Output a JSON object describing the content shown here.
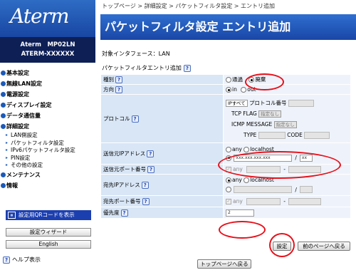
{
  "sidebar": {
    "logo": "Aterm",
    "model_line1": "Aterm　MP02LN",
    "model_line2": "ATERM-XXXXXX",
    "menu": [
      {
        "label": "基本設定"
      },
      {
        "label": "無線LAN設定"
      },
      {
        "label": "電源設定"
      },
      {
        "label": "ディスプレイ設定"
      },
      {
        "label": "データ通信量"
      },
      {
        "label": "詳細設定"
      }
    ],
    "submenu": [
      {
        "label": "LAN側設定"
      },
      {
        "label": "パケットフィルタ設定"
      },
      {
        "label": "IPv6パケットフィルタ設定"
      },
      {
        "label": "PIN設定"
      },
      {
        "label": "その他の設定"
      }
    ],
    "menu_bottom": [
      {
        "label": "メンテナンス"
      },
      {
        "label": "情報"
      }
    ],
    "qr_button": "設定用QRコードを表示",
    "wizard_button": "設定ウィザード",
    "english_button": "English",
    "help_label": "ヘルプ表示",
    "help_icon": "?"
  },
  "breadcrumb": "トップページ > 詳細設定 > パケットフィルタ設定 > エントリ追加",
  "title": "パケットフィルタ設定 エントリ追加",
  "interface_label": "対象インタフェース：LAN",
  "section_title": "パケットフィルタエントリ追加",
  "rows": {
    "type": {
      "label": "種別",
      "opt_pass": "通過",
      "opt_discard": "廃棄"
    },
    "direction": {
      "label": "方向",
      "opt_in": "in",
      "opt_out": "out"
    },
    "protocol": {
      "label": "プロトコル",
      "select": "IPすべて",
      "proto_num_label": "プロトコル番号",
      "tcp_flag_label": "TCP FLAG",
      "tcp_flag_select": "指定なし",
      "icmp_label": "ICMP MESSAGE",
      "icmp_select": "指定なし",
      "type_label": "TYPE",
      "code_label": "CODE"
    },
    "src_ip": {
      "label": "送信元IPアドレス",
      "opt_any": "any",
      "opt_localhost": "localhost",
      "ip_value": "xxx.xxx.xxx.xxx",
      "slash": "/",
      "mask_value": "xx"
    },
    "src_port": {
      "label": "送信元ポート番号",
      "any": "any",
      "dash": "-"
    },
    "dst_ip": {
      "label": "宛先IPアドレス",
      "opt_any": "any",
      "opt_localhost": "localhost",
      "slash": "/"
    },
    "dst_port": {
      "label": "宛先ポート番号",
      "any": "any",
      "dash": "-"
    },
    "priority": {
      "label": "優先度",
      "value": "2"
    }
  },
  "buttons": {
    "set": "設定",
    "back": "前のページへ戻る",
    "top": "トップページへ戻る"
  },
  "annotation_color": "#e8101a"
}
